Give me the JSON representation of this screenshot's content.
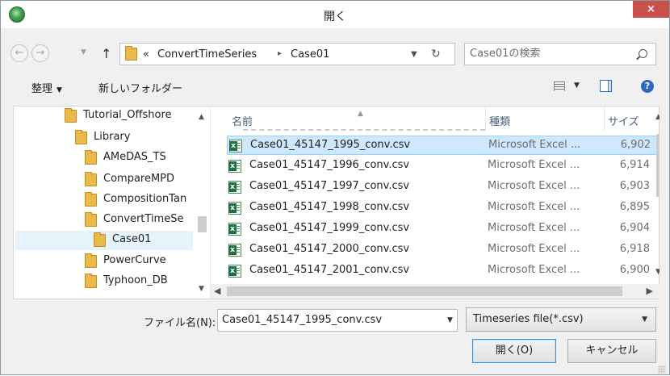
{
  "window": {
    "title": "開く",
    "close_label": "×"
  },
  "address": {
    "overflow": "«",
    "crumbs": [
      "ConvertTimeSeries",
      "Case01"
    ],
    "separator": "▸",
    "search_placeholder": "Case01の検索"
  },
  "toolbar": {
    "organize_label": "整理",
    "new_folder_label": "新しいフォルダー"
  },
  "tree": {
    "items": [
      {
        "label": "Tutorial_Offshore"
      },
      {
        "label": "Library"
      },
      {
        "label": "AMeDAS_TS"
      },
      {
        "label": "CompareMPD"
      },
      {
        "label": "CompositionTan"
      },
      {
        "label": "ConvertTimeSe"
      },
      {
        "label": "Case01",
        "selected": true
      },
      {
        "label": "PowerCurve"
      },
      {
        "label": "Typhoon_DB"
      }
    ]
  },
  "list": {
    "columns": {
      "name": "名前",
      "type": "種類",
      "size": "サイズ"
    },
    "files": [
      {
        "name": "Case01_45147_1995_conv.csv",
        "type": "Microsoft Excel ...",
        "size": "6,902",
        "selected": true
      },
      {
        "name": "Case01_45147_1996_conv.csv",
        "type": "Microsoft Excel ...",
        "size": "6,914"
      },
      {
        "name": "Case01_45147_1997_conv.csv",
        "type": "Microsoft Excel ...",
        "size": "6,903"
      },
      {
        "name": "Case01_45147_1998_conv.csv",
        "type": "Microsoft Excel ...",
        "size": "6,895"
      },
      {
        "name": "Case01_45147_1999_conv.csv",
        "type": "Microsoft Excel ...",
        "size": "6,904"
      },
      {
        "name": "Case01_45147_2000_conv.csv",
        "type": "Microsoft Excel ...",
        "size": "6,918"
      },
      {
        "name": "Case01_45147_2001_conv.csv",
        "type": "Microsoft Excel ...",
        "size": "6,900"
      }
    ]
  },
  "bottom": {
    "filename_label": "ファイル名(N):",
    "filename_value": "Case01_45147_1995_conv.csv",
    "filter_value": "Timeseries file(*.csv)",
    "open_label": "開く(O)",
    "cancel_label": "キャンセル"
  },
  "colors": {
    "close_button": "#c7504b",
    "selection": "#cde8ff",
    "folder": "#e9b94c",
    "excel": "#1e7145"
  }
}
